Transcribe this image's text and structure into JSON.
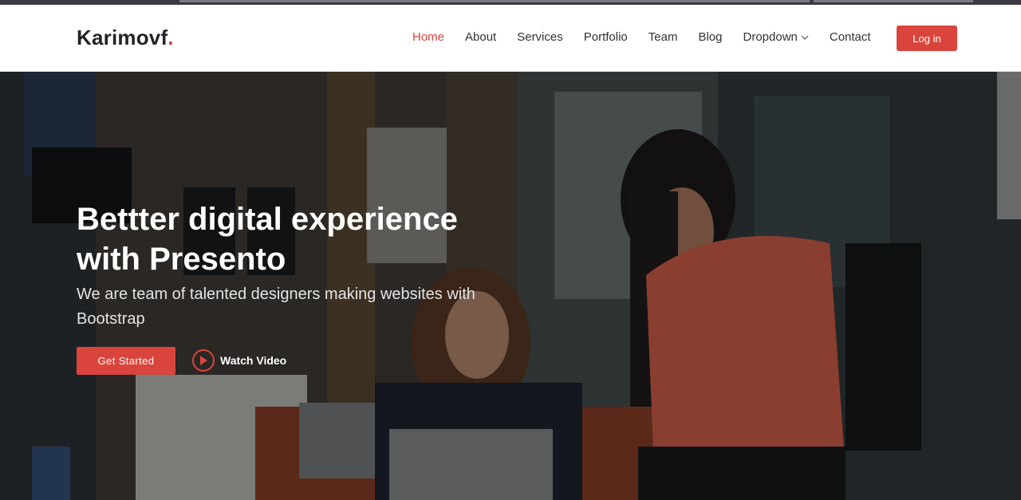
{
  "brand": {
    "name": "Karimovf",
    "dot": ".",
    "accent": "#d9453c"
  },
  "nav": {
    "items": [
      {
        "label": "Home",
        "active": true
      },
      {
        "label": "About"
      },
      {
        "label": "Services"
      },
      {
        "label": "Portfolio"
      },
      {
        "label": "Team"
      },
      {
        "label": "Blog"
      },
      {
        "label": "Dropdown",
        "icon": "chevron-down-icon"
      },
      {
        "label": "Contact"
      }
    ],
    "login_label": "Log in"
  },
  "hero": {
    "title_line1": "Bettter digital experience",
    "title_line2": "with Presento",
    "subtitle": "We are team of talented designers making websites with Bootstrap",
    "cta_label": "Get Started",
    "video_label": "Watch Video",
    "video_icon": "play-icon"
  }
}
